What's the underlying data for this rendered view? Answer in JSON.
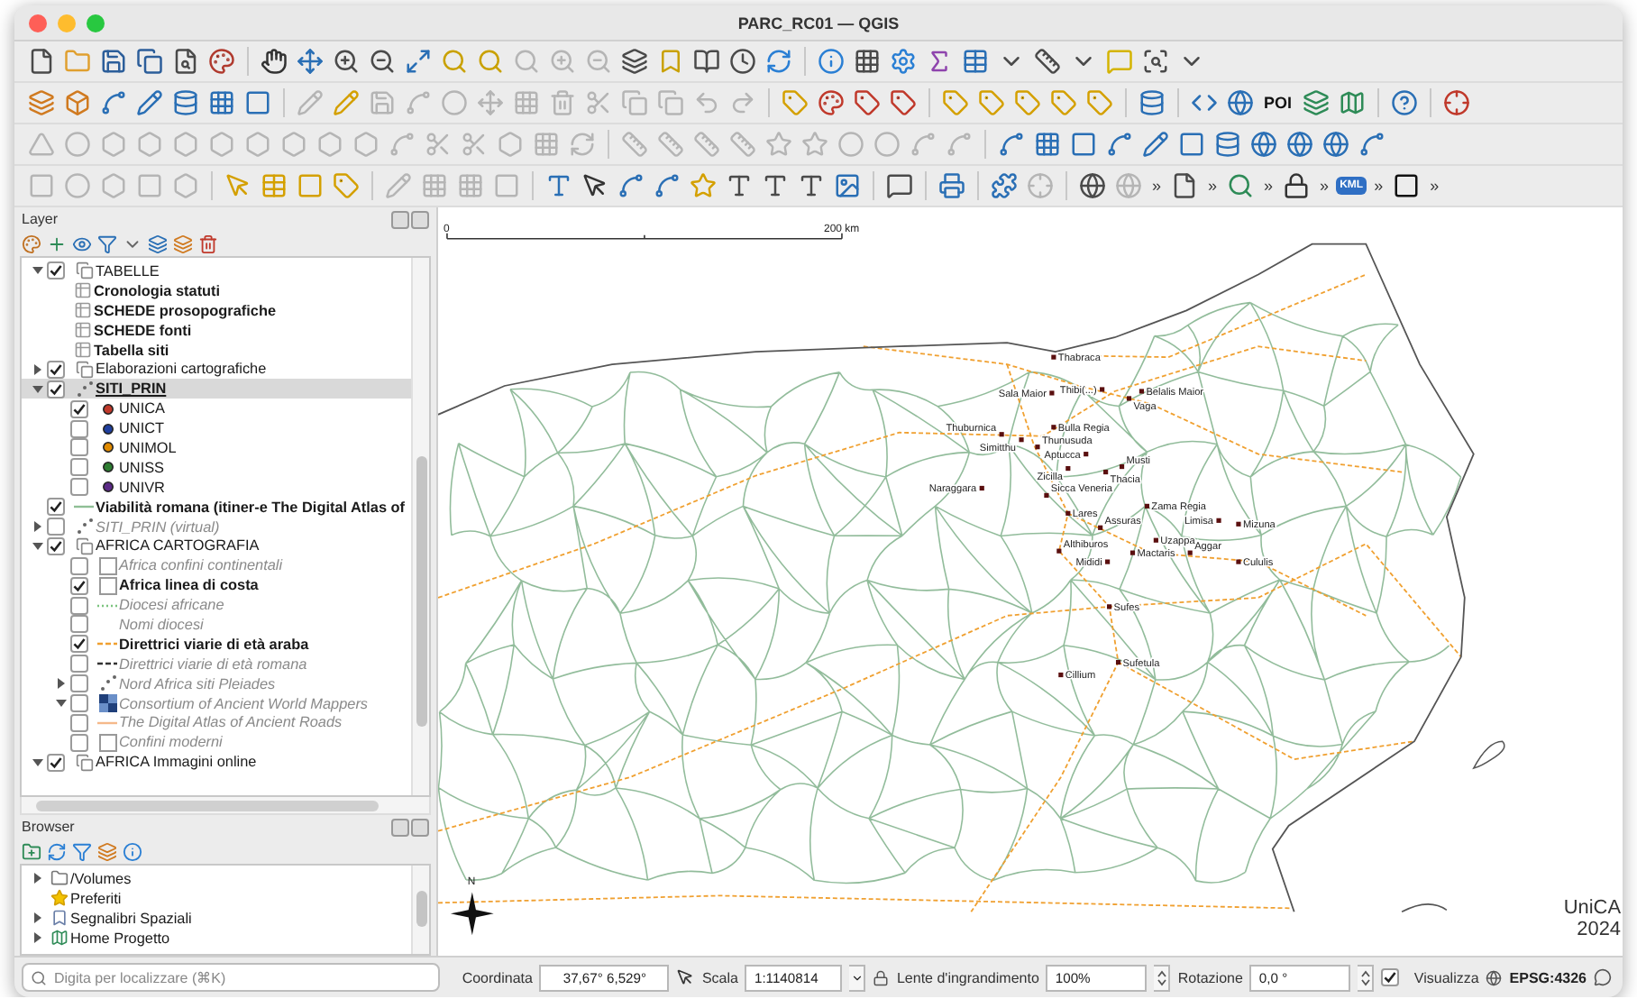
{
  "window": {
    "title": "PARC_RC01 — QGIS"
  },
  "toolbar_texts": {
    "poi": "POI",
    "kml": "KML",
    "more": [
      "»",
      "»",
      "»",
      "»",
      "»",
      "»"
    ]
  },
  "layers_panel": {
    "title": "Layer",
    "tree": [
      {
        "label": "TABELLE",
        "kind": "group",
        "checked": true,
        "expanded": true,
        "selected": false,
        "bold": false,
        "italic": false,
        "children": [
          {
            "label": "Cronologia statuti",
            "kind": "table",
            "selected": false,
            "bold": true,
            "italic": false
          },
          {
            "label": "SCHEDE prosopografiche",
            "kind": "table",
            "selected": false,
            "bold": true,
            "italic": false
          },
          {
            "label": "SCHEDE fonti",
            "kind": "table",
            "selected": false,
            "bold": true,
            "italic": false
          },
          {
            "label": "Tabella siti",
            "kind": "table",
            "selected": false,
            "bold": true,
            "italic": false
          }
        ]
      },
      {
        "label": "Elaborazioni cartografiche",
        "kind": "group",
        "checked": true,
        "expanded": false,
        "selected": false,
        "bold": false,
        "italic": false
      },
      {
        "label": "SITI_PRIN",
        "kind": "points",
        "checked": true,
        "expanded": true,
        "selected": true,
        "bold": true,
        "italic": false,
        "children": [
          {
            "label": "UNICA",
            "kind": "category",
            "checked": true,
            "selected": false,
            "bold": false,
            "italic": false,
            "color": "#c0392b"
          },
          {
            "label": "UNICT",
            "kind": "category",
            "checked": false,
            "selected": false,
            "bold": false,
            "italic": false,
            "color": "#1f3f9e"
          },
          {
            "label": "UNIMOL",
            "kind": "category",
            "checked": false,
            "selected": false,
            "bold": false,
            "italic": false,
            "color": "#e08a00"
          },
          {
            "label": "UNISS",
            "kind": "category",
            "checked": false,
            "selected": false,
            "bold": false,
            "italic": false,
            "color": "#2e7d32"
          },
          {
            "label": "UNIVR",
            "kind": "category",
            "checked": false,
            "selected": false,
            "bold": false,
            "italic": false,
            "color": "#5b2a86"
          }
        ]
      },
      {
        "label": "Viabilità romana (itiner-e The Digital Atlas of",
        "kind": "line",
        "checked": true,
        "selected": false,
        "bold": true,
        "italic": false,
        "color": "#8fbf95"
      },
      {
        "label": "SITI_PRIN (virtual)",
        "kind": "points",
        "checked": false,
        "expanded": false,
        "selected": false,
        "bold": false,
        "italic": true
      },
      {
        "label": "AFRICA CARTOGRAFIA",
        "kind": "group",
        "checked": true,
        "expanded": true,
        "selected": false,
        "bold": false,
        "italic": false,
        "children": [
          {
            "label": "Africa confini continentali",
            "kind": "polygon",
            "checked": false,
            "selected": false,
            "bold": false,
            "italic": true
          },
          {
            "label": "Africa linea di costa",
            "kind": "polygon",
            "checked": true,
            "selected": false,
            "bold": true,
            "italic": false
          },
          {
            "label": "Diocesi africane",
            "kind": "dotted_line",
            "checked": false,
            "selected": false,
            "bold": false,
            "italic": true,
            "color": "#7cc47f"
          },
          {
            "label": "Nomi diocesi",
            "kind": "none",
            "checked": false,
            "selected": false,
            "bold": false,
            "italic": true
          },
          {
            "label": "Direttrici viarie di età araba",
            "kind": "dashed_line",
            "checked": true,
            "selected": false,
            "bold": true,
            "italic": false,
            "color": "#f0a030"
          },
          {
            "label": "Direttrici viarie di età romana",
            "kind": "dashed_line",
            "checked": false,
            "selected": false,
            "bold": false,
            "italic": true,
            "color": "#333333"
          },
          {
            "label": "Nord Africa siti Pleiades",
            "kind": "points",
            "checked": false,
            "expanded": false,
            "selected": false,
            "bold": false,
            "italic": true
          },
          {
            "label": "Consortium of Ancient World Mappers",
            "kind": "raster",
            "checked": false,
            "expanded": true,
            "selected": false,
            "bold": false,
            "italic": true
          },
          {
            "label": "The Digital Atlas of Ancient Roads",
            "kind": "line",
            "checked": false,
            "selected": false,
            "bold": false,
            "italic": true,
            "color": "#f5b98a"
          },
          {
            "label": "Confini moderni",
            "kind": "polygon",
            "checked": false,
            "selected": false,
            "bold": false,
            "italic": true
          }
        ]
      },
      {
        "label": "AFRICA Immagini online",
        "kind": "group",
        "checked": true,
        "expanded": true,
        "selected": false,
        "bold": false,
        "italic": false
      }
    ]
  },
  "browser_panel": {
    "title": "Browser",
    "items": [
      {
        "label": "/Volumes",
        "kind": "folder",
        "expanded": false
      },
      {
        "label": "Preferiti",
        "kind": "favorites"
      },
      {
        "label": "Segnalibri Spaziali",
        "kind": "bookmarks",
        "expanded": false
      },
      {
        "label": "Home Progetto",
        "kind": "project",
        "expanded": false
      }
    ]
  },
  "map": {
    "scale_bar": {
      "start": "0",
      "end": "200 km"
    },
    "north": "N",
    "sites": [
      "Thabraca",
      "Sala Maior",
      "Thibi(...)",
      "Belalis Maior",
      "Vaga",
      "Bulla Regia",
      "Thuburnica",
      "Simitthu",
      "Thunusuda",
      "Aptucca",
      "Zicilla",
      "Musti",
      "Thacia",
      "Naraggara",
      "Sicca Veneria",
      "Zama Regia",
      "Lares",
      "Limisa",
      "Mizuna",
      "Assuras",
      "Uzappa",
      "Althiburos",
      "Mactaris",
      "Aggar",
      "Mididi",
      "Cululis",
      "Sufes",
      "Sufetula",
      "Cillium"
    ],
    "credit": [
      "UniCA",
      "2024"
    ]
  },
  "status_bar": {
    "search_placeholder": "Digita per localizzare (⌘K)",
    "coordinate_label": "Coordinata",
    "coordinate": "37,67° 6,529°",
    "scale_label": "Scala",
    "scale": "1:1140814",
    "magnifier_label": "Lente d'ingrandimento",
    "magnifier": "100%",
    "rotation_label": "Rotazione",
    "rotation": "0,0 °",
    "render_label": "Visualizza",
    "render_checked": true,
    "crs": "EPSG:4326"
  }
}
